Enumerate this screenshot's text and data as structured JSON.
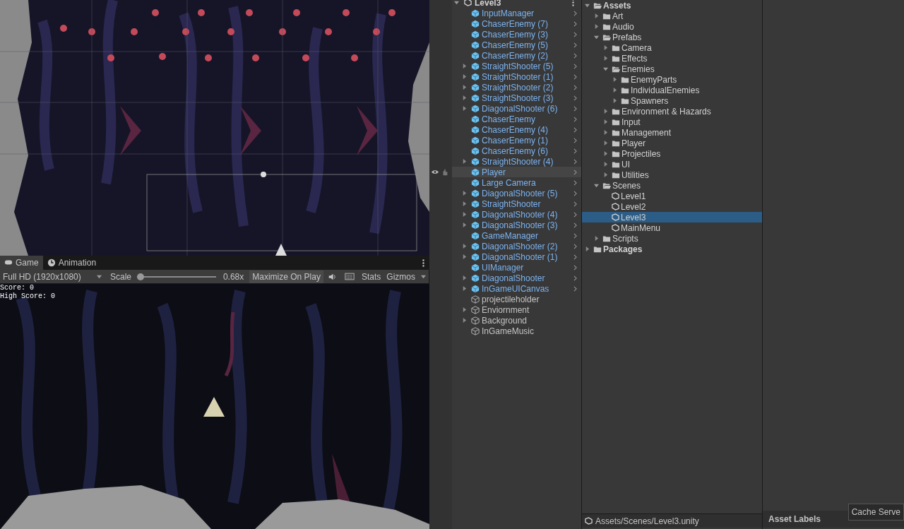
{
  "game_panel": {
    "tabs": [
      {
        "label": "Game",
        "selected": true
      },
      {
        "label": "Animation",
        "selected": false
      }
    ],
    "toolbar": {
      "resolution": "Full HD (1920x1080)",
      "scale_label": "Scale",
      "scale": {
        "level": 0.0
      },
      "scale_reading": "0.68x",
      "maximize_on_play": {
        "label": "Maximize On Play",
        "on": false
      },
      "stats": "Stats",
      "gizmos": "Gizmos"
    },
    "overlay": [
      "Score: 0",
      "High Score: 0"
    ]
  },
  "hierarchy": {
    "scene": "Level3",
    "expanded": true,
    "items": [
      {
        "name": "InputManager",
        "kind": "prefab",
        "has_children": false,
        "highlighted": false
      },
      {
        "name": "ChaserEnemy (7)",
        "kind": "prefab",
        "has_children": false,
        "highlighted": false
      },
      {
        "name": "ChaserEnemy (3)",
        "kind": "prefab",
        "has_children": false,
        "highlighted": false
      },
      {
        "name": "ChaserEnemy (5)",
        "kind": "prefab",
        "has_children": false,
        "highlighted": false
      },
      {
        "name": "ChaserEnemy (2)",
        "kind": "prefab",
        "has_children": false,
        "highlighted": false
      },
      {
        "name": "StraightShooter (5)",
        "kind": "prefab",
        "has_children": true,
        "highlighted": false
      },
      {
        "name": "StraightShooter (1)",
        "kind": "prefab",
        "has_children": true,
        "highlighted": false
      },
      {
        "name": "StraightShooter (2)",
        "kind": "prefab",
        "has_children": true,
        "highlighted": false
      },
      {
        "name": "StraightShooter (3)",
        "kind": "prefab",
        "has_children": true,
        "highlighted": false
      },
      {
        "name": "DiagonalShooter (6)",
        "kind": "prefab",
        "has_children": true,
        "highlighted": false
      },
      {
        "name": "ChaserEnemy",
        "kind": "prefab",
        "has_children": false,
        "highlighted": false
      },
      {
        "name": "ChaserEnemy (4)",
        "kind": "prefab",
        "has_children": false,
        "highlighted": false
      },
      {
        "name": "ChaserEnemy (1)",
        "kind": "prefab",
        "has_children": false,
        "highlighted": false
      },
      {
        "name": "ChaserEnemy (6)",
        "kind": "prefab",
        "has_children": false,
        "highlighted": false
      },
      {
        "name": "StraightShooter (4)",
        "kind": "prefab",
        "has_children": true,
        "highlighted": false
      },
      {
        "name": "Player",
        "kind": "prefab",
        "has_children": false,
        "highlighted": true
      },
      {
        "name": "Large Camera",
        "kind": "prefab",
        "has_children": false,
        "highlighted": false
      },
      {
        "name": "DiagonalShooter (5)",
        "kind": "prefab",
        "has_children": true,
        "highlighted": false
      },
      {
        "name": "StraightShooter",
        "kind": "prefab",
        "has_children": true,
        "highlighted": false
      },
      {
        "name": "DiagonalShooter (4)",
        "kind": "prefab",
        "has_children": true,
        "highlighted": false
      },
      {
        "name": "DiagonalShooter (3)",
        "kind": "prefab",
        "has_children": true,
        "highlighted": false
      },
      {
        "name": "GameManager",
        "kind": "prefab",
        "has_children": false,
        "highlighted": false
      },
      {
        "name": "DiagonalShooter (2)",
        "kind": "prefab",
        "has_children": true,
        "highlighted": false
      },
      {
        "name": "DiagonalShooter (1)",
        "kind": "prefab",
        "has_children": true,
        "highlighted": false
      },
      {
        "name": "UIManager",
        "kind": "prefab",
        "has_children": false,
        "highlighted": false
      },
      {
        "name": "DiagonalShooter",
        "kind": "prefab",
        "has_children": true,
        "highlighted": false
      },
      {
        "name": "InGameUICanvas",
        "kind": "prefab",
        "has_children": true,
        "highlighted": false
      },
      {
        "name": "projectileholder",
        "kind": "object",
        "has_children": false,
        "highlighted": false
      },
      {
        "name": "Enviornment",
        "kind": "object",
        "has_children": true,
        "highlighted": false
      },
      {
        "name": "Background",
        "kind": "object",
        "has_children": true,
        "highlighted": false
      },
      {
        "name": "InGameMusic",
        "kind": "object",
        "has_children": false,
        "highlighted": false
      }
    ]
  },
  "project": {
    "tree": [
      {
        "name": "Assets",
        "kind": "folder",
        "expanded": true,
        "selected": false,
        "children": [
          {
            "name": "Art",
            "kind": "folder",
            "expanded": false,
            "selected": false
          },
          {
            "name": "Audio",
            "kind": "folder",
            "expanded": false,
            "selected": false
          },
          {
            "name": "Prefabs",
            "kind": "folder",
            "expanded": true,
            "selected": false,
            "children": [
              {
                "name": "Camera",
                "kind": "folder",
                "expanded": false,
                "selected": false
              },
              {
                "name": "Effects",
                "kind": "folder",
                "expanded": false,
                "selected": false
              },
              {
                "name": "Enemies",
                "kind": "folder",
                "expanded": true,
                "selected": false,
                "children": [
                  {
                    "name": "EnemyParts",
                    "kind": "folder",
                    "expanded": false,
                    "selected": false
                  },
                  {
                    "name": "IndividualEnemies",
                    "kind": "folder",
                    "expanded": false,
                    "selected": false
                  },
                  {
                    "name": "Spawners",
                    "kind": "folder",
                    "expanded": false,
                    "selected": false
                  }
                ]
              },
              {
                "name": "Environment & Hazards",
                "kind": "folder",
                "expanded": false,
                "selected": false
              },
              {
                "name": "Input",
                "kind": "folder",
                "expanded": false,
                "selected": false
              },
              {
                "name": "Management",
                "kind": "folder",
                "expanded": false,
                "selected": false
              },
              {
                "name": "Player",
                "kind": "folder",
                "expanded": false,
                "selected": false
              },
              {
                "name": "Projectiles",
                "kind": "folder",
                "expanded": false,
                "selected": false
              },
              {
                "name": "UI",
                "kind": "folder",
                "expanded": false,
                "selected": false
              },
              {
                "name": "Utilities",
                "kind": "folder",
                "expanded": false,
                "selected": false
              }
            ]
          },
          {
            "name": "Scenes",
            "kind": "folder",
            "expanded": true,
            "selected": false,
            "children": [
              {
                "name": "Level1",
                "kind": "scene",
                "selected": false
              },
              {
                "name": "Level2",
                "kind": "scene",
                "selected": false
              },
              {
                "name": "Level3",
                "kind": "scene",
                "selected": true
              },
              {
                "name": "MainMenu",
                "kind": "scene",
                "selected": false
              }
            ]
          },
          {
            "name": "Scripts",
            "kind": "folder",
            "expanded": false,
            "selected": false
          }
        ]
      },
      {
        "name": "Packages",
        "kind": "folder",
        "expanded": false,
        "selected": false
      }
    ],
    "path": "Assets/Scenes/Level3.unity"
  },
  "inspector": {
    "section": "Asset Labels",
    "tooltip": "Cache Serve"
  }
}
